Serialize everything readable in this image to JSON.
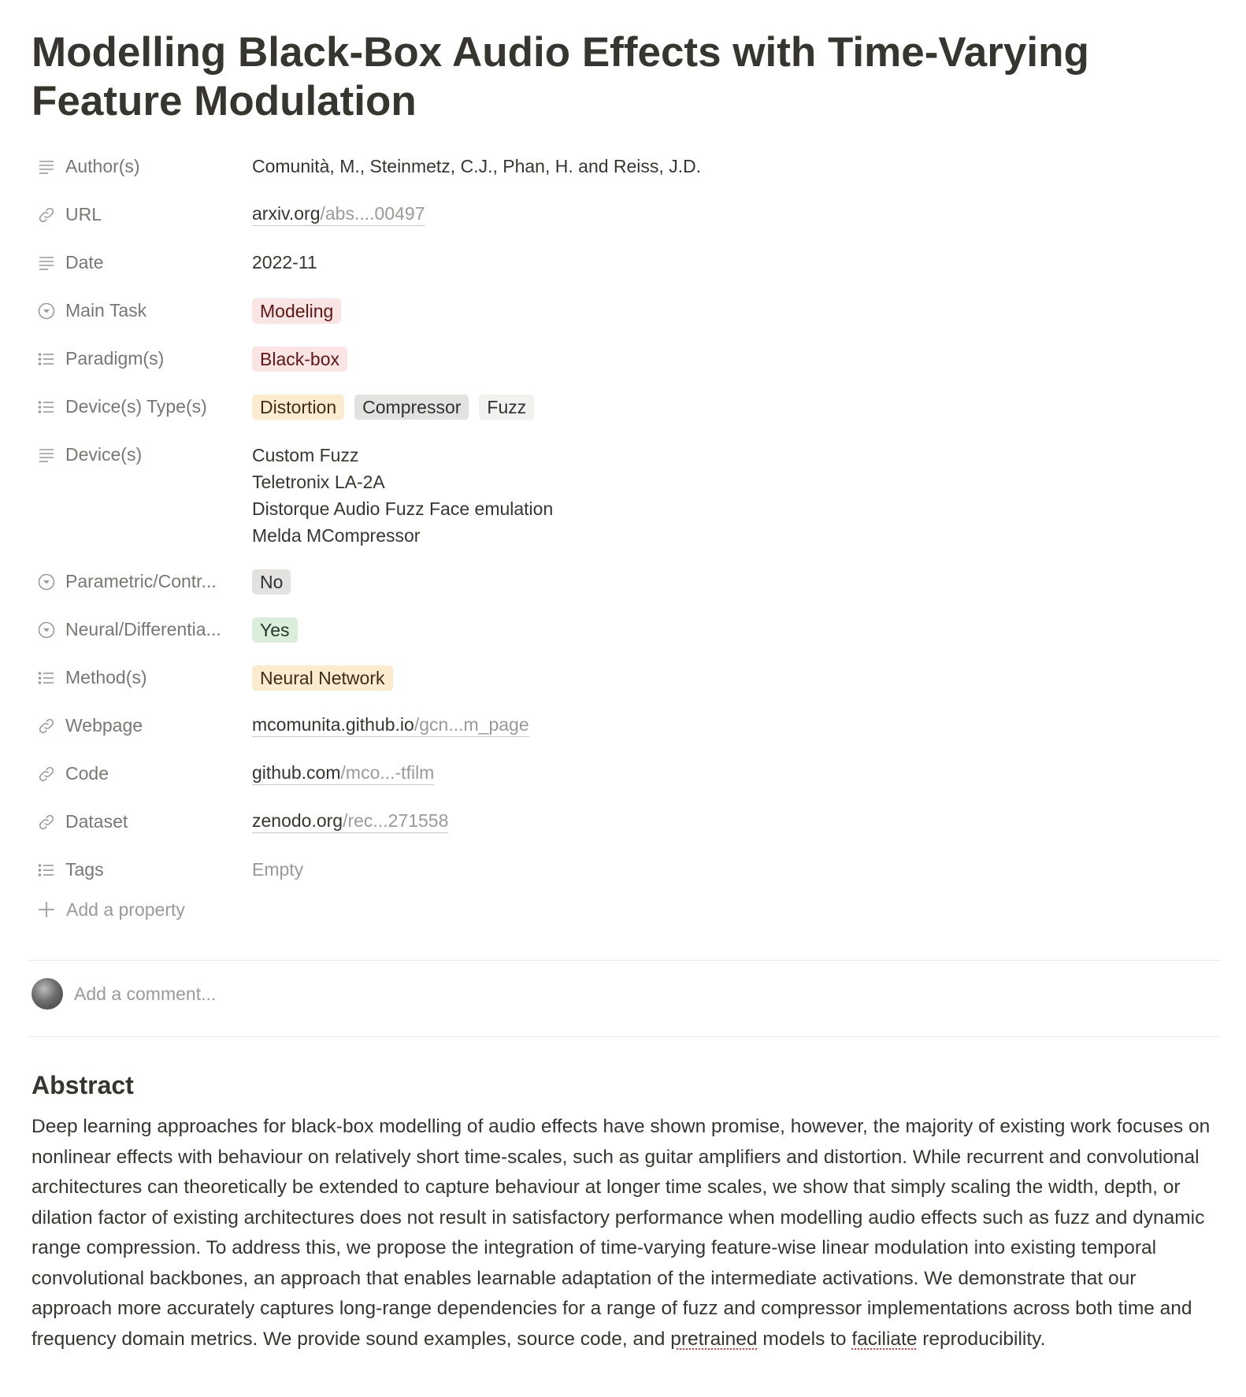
{
  "title": "Modelling Black-Box Audio Effects with Time-Varying Feature Modulation",
  "properties": {
    "authors": {
      "label": "Author(s)",
      "value": "Comunità, M., Steinmetz, C.J., Phan, H. and Reiss, J.D.",
      "icon": "text-lines-icon"
    },
    "url": {
      "label": "URL",
      "domain": "arxiv.org",
      "path": "/abs....00497",
      "icon": "link-icon"
    },
    "date": {
      "label": "Date",
      "value": "2022-11",
      "icon": "text-lines-icon"
    },
    "main_task": {
      "label": "Main Task",
      "tags": [
        "Modeling"
      ],
      "icon": "select-icon"
    },
    "paradigms": {
      "label": "Paradigm(s)",
      "tags": [
        "Black-box"
      ],
      "icon": "list-icon"
    },
    "device_types": {
      "label": "Device(s) Type(s)",
      "tags": [
        "Distortion",
        "Compressor",
        "Fuzz"
      ],
      "icon": "list-icon"
    },
    "devices": {
      "label": "Device(s)",
      "values": [
        "Custom Fuzz",
        "Teletronix LA-2A",
        "Distorque Audio Fuzz Face emulation",
        "Melda MCompressor"
      ],
      "icon": "text-lines-icon"
    },
    "parametric": {
      "label": "Parametric/Contr...",
      "tags": [
        "No"
      ],
      "icon": "select-icon"
    },
    "neural": {
      "label": "Neural/Differentia...",
      "tags": [
        "Yes"
      ],
      "icon": "select-icon"
    },
    "methods": {
      "label": "Method(s)",
      "tags": [
        "Neural Network"
      ],
      "icon": "list-icon"
    },
    "webpage": {
      "label": "Webpage",
      "domain": "mcomunita.github.io",
      "path": "/gcn...m_page",
      "icon": "link-icon"
    },
    "code": {
      "label": "Code",
      "domain": "github.com",
      "path": "/mco...-tfilm",
      "icon": "link-icon"
    },
    "dataset": {
      "label": "Dataset",
      "domain": "zenodo.org",
      "path": "/rec...271558",
      "icon": "link-icon"
    },
    "tags": {
      "label": "Tags",
      "value": "Empty",
      "icon": "list-icon"
    }
  },
  "add_property": "Add a property",
  "comment": {
    "placeholder": "Add a comment..."
  },
  "abstract": {
    "heading": "Abstract",
    "text_before": "Deep learning approaches for black-box modelling of audio effects have shown promise, however, the majority of existing work focuses on nonlinear effects with behaviour on relatively short time-scales, such as guitar amplifiers and distortion. While recurrent and convolutional architectures can theoretically be extended to capture behaviour at longer time scales, we show that simply scaling the width, depth, or dilation factor of existing architectures does not result in satisfactory performance when modelling audio effects such as fuzz and dynamic range compression. To address this, we propose the integration of time-varying feature-wise linear modulation into existing temporal convolutional backbones, an approach that enables learnable adaptation of the intermediate activations. We demonstrate that our approach more accurately captures long-range dependencies for a range of fuzz and compressor implementations across both time and frequency domain metrics. We provide sound examples, source code, and ",
    "word_pretrained": "pretrained",
    "text_middle": " models to ",
    "word_faciliate": "faciliate",
    "text_after": " reproducibility."
  },
  "colors": {
    "text": "#37352f",
    "muted": "#787774",
    "placeholder": "#9b9a97",
    "tag_red": "#fbe4e4",
    "tag_yellow": "#fbecd0",
    "tag_gray": "#e3e2e0",
    "tag_light": "#f1f1ef",
    "tag_green": "#dbeddb"
  }
}
